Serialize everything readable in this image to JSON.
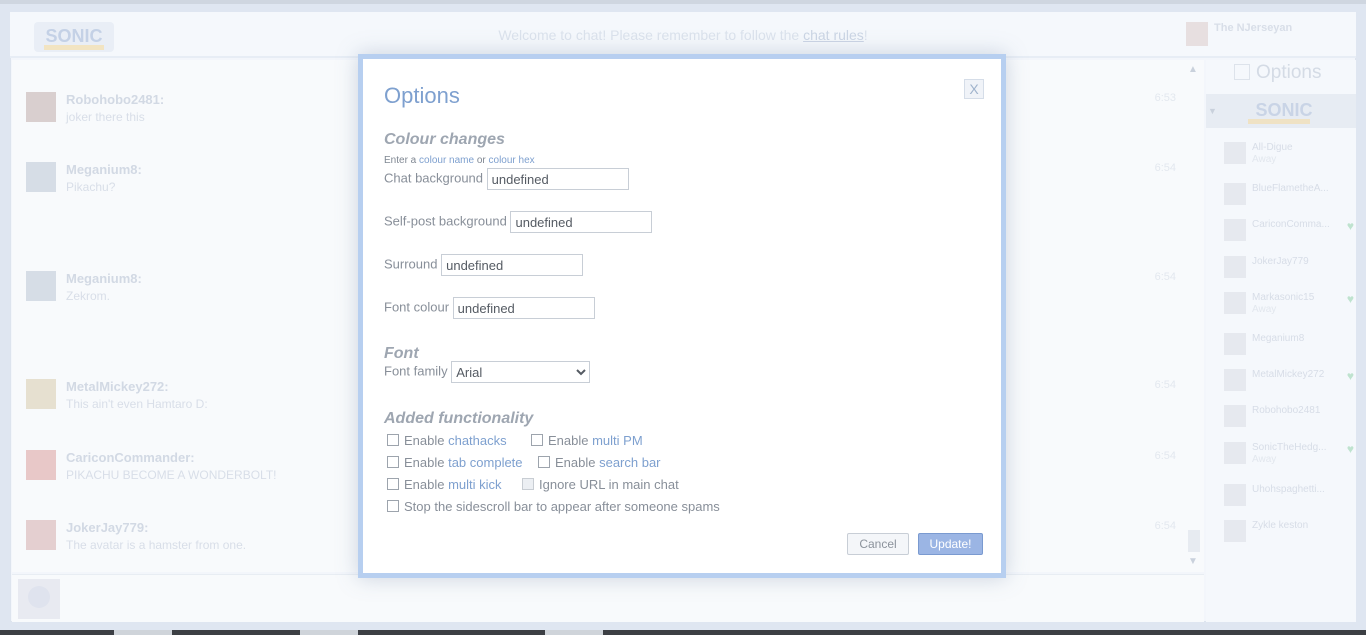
{
  "header": {
    "welcome_prefix": "Welcome to chat! Please remember to follow the ",
    "welcome_link": "chat rules",
    "welcome_suffix": "!",
    "current_user": "The NJerseyan"
  },
  "messages": [
    {
      "name": "Robohobo2481:",
      "text": "joker there this",
      "time": "6:53",
      "avatar_color": "#d9cfcf"
    },
    {
      "name": "Meganium8:",
      "text": "Pikachu?",
      "time": "6:54",
      "avatar_color": "#d6dde6"
    },
    {
      "name": "Meganium8:",
      "text": "Zekrom.",
      "time": "6:54",
      "avatar_color": "#d6dde6"
    },
    {
      "name": "MetalMickey272:",
      "text": "This ain't even Hamtaro D:",
      "time": "6:54",
      "avatar_color": "#e6e0d0"
    },
    {
      "name": "CariconCommander:",
      "text": "PIKACHU BECOME A WONDERBOLT!",
      "time": "6:54",
      "avatar_color": "#e8c8c8"
    },
    {
      "name": "JokerJay779:",
      "text": "The avatar is a hamster from one.",
      "time": "6:54",
      "avatar_color": "#e4cfd0"
    }
  ],
  "sidebar": {
    "options_label": "Options",
    "users": [
      {
        "name": "All-Digue",
        "status": "Away",
        "badge": ""
      },
      {
        "name": "BlueFlametheA...",
        "status": "",
        "badge": ""
      },
      {
        "name": "CariconComma...",
        "status": "",
        "badge": "♥"
      },
      {
        "name": "JokerJay779",
        "status": "",
        "badge": ""
      },
      {
        "name": "Markasonic15",
        "status": "Away",
        "badge": "♥"
      },
      {
        "name": "Meganium8",
        "status": "",
        "badge": ""
      },
      {
        "name": "MetalMickey272",
        "status": "",
        "badge": "♥"
      },
      {
        "name": "Robohobo2481",
        "status": "",
        "badge": ""
      },
      {
        "name": "SonicTheHedg...",
        "status": "Away",
        "badge": "♥"
      },
      {
        "name": "Uhohspaghetti...",
        "status": "",
        "badge": ""
      },
      {
        "name": "Zykle keston",
        "status": "",
        "badge": ""
      }
    ]
  },
  "modal": {
    "title": "Options",
    "close_label": "X",
    "colour_section": "Colour changes",
    "hint_prefix": "Enter a ",
    "hint_link1": "colour name",
    "hint_mid": " or ",
    "hint_link2": "colour hex",
    "chat_bg_label": "Chat background",
    "chat_bg_value": "undefined",
    "self_bg_label": "Self-post background",
    "self_bg_value": "undefined",
    "surround_label": "Surround",
    "surround_value": "undefined",
    "font_colour_label": "Font colour",
    "font_colour_value": "undefined",
    "font_section": "Font",
    "font_family_label": "Font family",
    "font_family_value": "Arial",
    "func_section": "Added functionality",
    "cb_chathacks_prefix": "Enable ",
    "cb_chathacks_hl": "chathacks",
    "cb_multipm_prefix": "Enable ",
    "cb_multipm_hl": "multi PM",
    "cb_tab_prefix": "Enable ",
    "cb_tab_hl": "tab complete",
    "cb_search_prefix": "Enable ",
    "cb_search_hl": "search bar",
    "cb_kick_prefix": "Enable ",
    "cb_kick_hl": "multi kick",
    "cb_ignore_url": "Ignore URL in main chat",
    "cb_sidescroll": "Stop the sidescroll bar to appear after someone spams",
    "cancel_label": "Cancel",
    "update_label": "Update!"
  }
}
